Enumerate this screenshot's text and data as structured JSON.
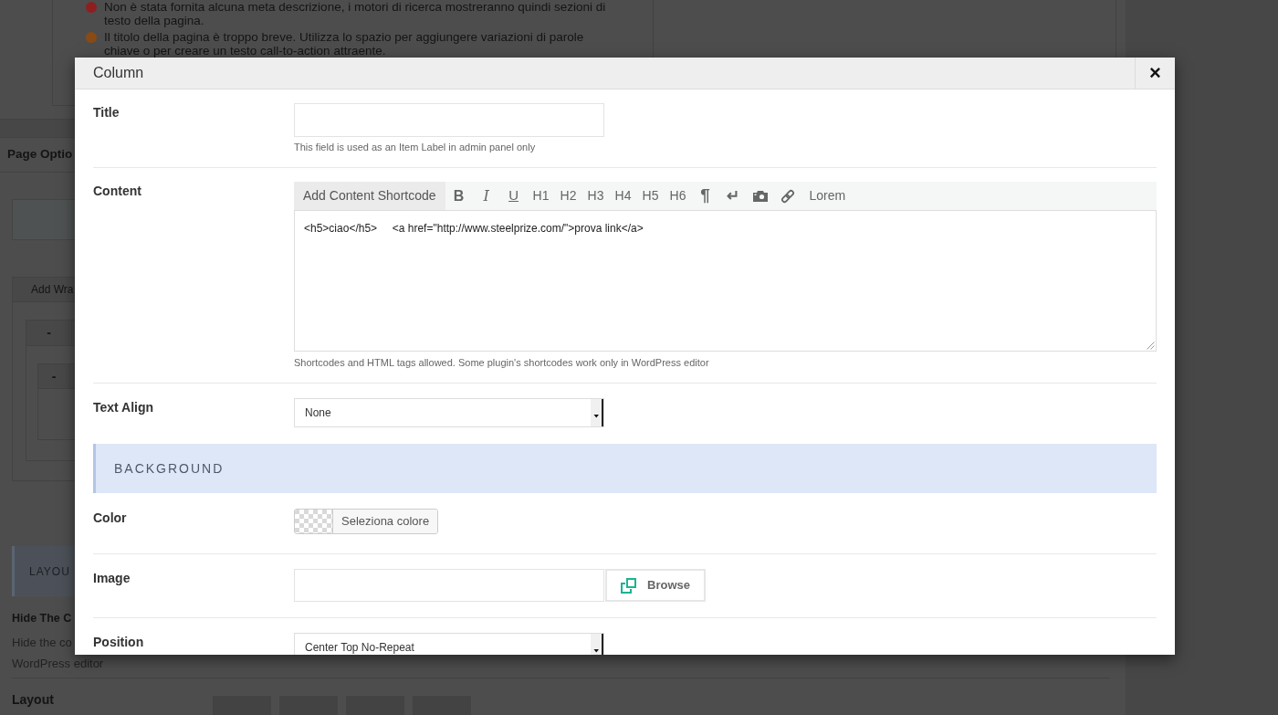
{
  "background_page": {
    "notices": [
      {
        "text": "Non è stata fornita alcuna meta descrizione, i motori di ricerca mostreranno quindi sezioni di testo della pagina.",
        "color": "#8f1f1f"
      },
      {
        "text": "Il titolo della pagina è troppo breve. Utilizza lo spazio per aggiungere variazioni di parole chiave o per creare un testo call-to-action attraente.",
        "color": "#8a4a14"
      }
    ],
    "panel_title": "Page Optio",
    "tab": "Add Wra",
    "collapse_buttons": [
      "-",
      "-"
    ],
    "section_header": "LAYOU",
    "field": {
      "label": "Hide The C",
      "description_lines": [
        "Hide the co",
        "WordPress editor"
      ]
    },
    "layout_label": "Layout"
  },
  "modal": {
    "title": "Column",
    "close_button": "×",
    "fields": [
      {
        "kind": "text",
        "label": "Title",
        "description": "This field is used as an Item Label in admin panel only"
      },
      {
        "kind": "editor",
        "label": "Content",
        "toolbar": {
          "shortcode_button": "Add Content Shortcode",
          "buttons": [
            {
              "kind": "bold",
              "label": "B"
            },
            {
              "kind": "italic",
              "label": "I"
            },
            {
              "kind": "underline",
              "label": "U"
            },
            {
              "kind": "heading",
              "label": "H1"
            },
            {
              "kind": "heading",
              "label": "H2"
            },
            {
              "kind": "heading",
              "label": "H3"
            },
            {
              "kind": "heading",
              "label": "H4"
            },
            {
              "kind": "heading",
              "label": "H5"
            },
            {
              "kind": "heading",
              "label": "H6"
            },
            {
              "kind": "paragraph",
              "label": "¶"
            },
            {
              "kind": "linebreak",
              "label": "↵"
            },
            {
              "kind": "media"
            },
            {
              "kind": "link"
            },
            {
              "kind": "shortcode",
              "label": "Lorem"
            }
          ]
        },
        "value": "<h5>ciao</h5>     <a href=\"http://www.steelprize.com/\">prova link</a>",
        "description": "Shortcodes and HTML tags allowed. Some plugin's shortcodes work only in WordPress editor"
      },
      {
        "kind": "select",
        "label": "Text Align",
        "value": "None"
      },
      {
        "kind": "section",
        "label": "BACKGROUND"
      },
      {
        "kind": "color",
        "label": "Color",
        "button": "Seleziona colore"
      },
      {
        "kind": "image",
        "label": "Image",
        "button": "Browse"
      },
      {
        "kind": "select",
        "label": "Position",
        "value": "Center Top No-Repeat"
      }
    ]
  }
}
